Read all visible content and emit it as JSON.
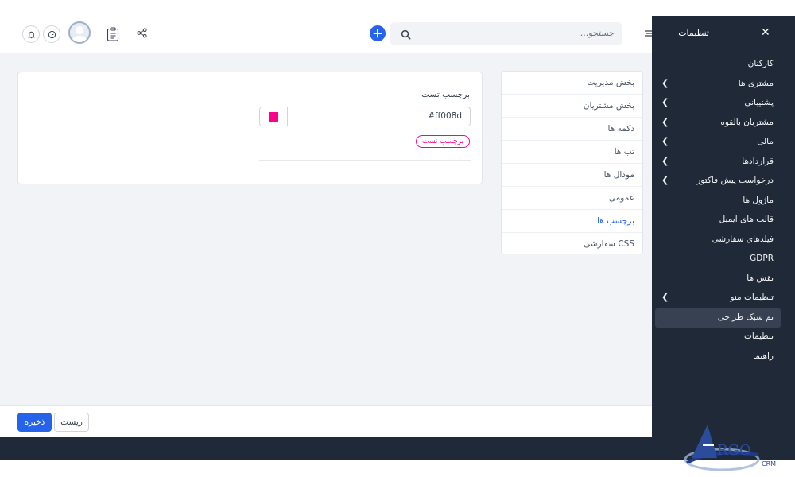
{
  "header": {
    "search_placeholder": "جستجو...",
    "icons": [
      "bell-icon",
      "clock-icon",
      "avatar",
      "clipboard-icon",
      "share-icon",
      "plus-icon",
      "search-icon",
      "menu-icon"
    ]
  },
  "settings_tabs": {
    "items": [
      {
        "label": "بخش مدیریت"
      },
      {
        "label": "بخش مشتریان"
      },
      {
        "label": "دکمه ها"
      },
      {
        "label": "تب ها"
      },
      {
        "label": "مودال ها"
      },
      {
        "label": "عمومی"
      },
      {
        "label": "برچسب ها"
      },
      {
        "label": "CSS سفارشی"
      }
    ],
    "active_index": 6
  },
  "label_panel": {
    "title": "برچسب تست",
    "color_value": "#ff008d",
    "preview_tag": "برچسب تست",
    "accent_color": "#ff008d"
  },
  "footer": {
    "save_label": "ذخیره",
    "reset_label": "ریست"
  },
  "sidebar": {
    "title": "تنظیمات",
    "items": [
      {
        "label": "کارکنان",
        "has_children": false
      },
      {
        "label": "مشتری ها",
        "has_children": true
      },
      {
        "label": "پشتیبانی",
        "has_children": true
      },
      {
        "label": "مشتریان بالقوه",
        "has_children": true
      },
      {
        "label": "مالی",
        "has_children": true
      },
      {
        "label": "قراردادها",
        "has_children": true
      },
      {
        "label": "درخواست پیش فاکتور",
        "has_children": true
      },
      {
        "label": "ماژول ها",
        "has_children": false
      },
      {
        "label": "قالب های ایمیل",
        "has_children": false
      },
      {
        "label": "فیلدهای سفارشی",
        "has_children": false
      },
      {
        "label": "GDPR",
        "has_children": false
      },
      {
        "label": "نقش ها",
        "has_children": false
      },
      {
        "label": "تنظیمات منو",
        "has_children": true
      },
      {
        "label": "تم سبک طراحی",
        "has_children": false,
        "active": true
      },
      {
        "label": "تنظیمات",
        "has_children": false
      },
      {
        "label": "راهنما",
        "has_children": false
      }
    ]
  },
  "logo": {
    "text": "ARGO",
    "sub": "CRM"
  },
  "colors": {
    "primary": "#2563eb",
    "sidebar_bg": "#1f2937",
    "content_bg": "#f1f3f6"
  }
}
